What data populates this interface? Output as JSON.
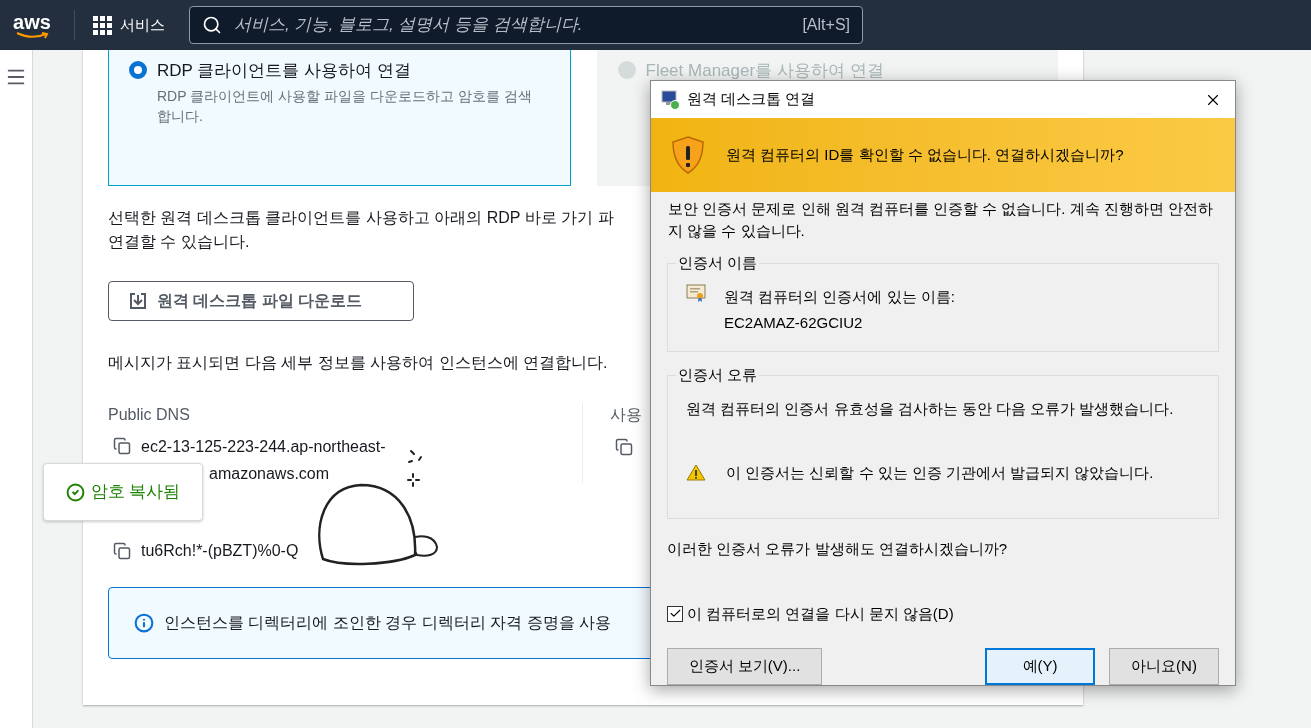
{
  "nav": {
    "logo": "aws",
    "services": "서비스",
    "search_placeholder": "서비스, 기능, 블로그, 설명서 등을 검색합니다.",
    "shortcut": "[Alt+S]"
  },
  "connect_options": [
    {
      "title": "RDP 클라이언트를 사용하여 연결",
      "description": "RDP 클라이언트에 사용할 파일을 다운로드하고 암호를 검색합니다.",
      "selected": true
    },
    {
      "title": "Fleet Manager를 사용하여 연결",
      "selected": false
    }
  ],
  "intro_lines": [
    "선택한 원격 데스크톱 클라이언트를 사용하고 아래의 RDP 바로 가기 파",
    "연결할 수 있습니다."
  ],
  "download_button": "원격 데스크톱 파일 다운로드",
  "message": "메시지가 표시되면 다음 세부 정보를 사용하여 인스턴스에 연결합니다.",
  "details": {
    "dns_label": "Public DNS",
    "dns_lines": [
      "ec2-13-125-223-244.ap-northeast-",
      "amazonaws.com"
    ],
    "password": "tu6Rch!*-(pBZT)%0-Q",
    "column_2_label": "사용"
  },
  "toast": "암호 복사됨",
  "info": "인스턴스를 디렉터리에 조인한 경우 디렉터리 자격 증명을 사용",
  "dialog": {
    "title": "원격 데스크톱 연결",
    "banner": "원격 컴퓨터의 ID를 확인할 수 없습니다. 연결하시겠습니까?",
    "body": "보안 인증서 문제로 인해 원격 컴퓨터를 인증할 수 없습니다. 계속 진행하면 안전하지 않을 수 있습니다.",
    "groups": [
      {
        "kind": "name",
        "title": "인증서 이름",
        "label": "원격 컴퓨터의 인증서에 있는 이름:",
        "value": "EC2AMAZ-62GCIU2"
      },
      {
        "kind": "error",
        "title": "인증서 오류",
        "label": "원격 컴퓨터의 인증서 유효성을 검사하는 동안 다음 오류가 발생했습니다.",
        "value": "이 인증서는 신뢰할 수 있는 인증 기관에서 발급되지 않았습니다."
      }
    ],
    "question": "이러한 인증서 오류가 발생해도 연결하시겠습니까?",
    "checkbox": {
      "label": "이 컴퓨터로의 연결을 다시 묻지 않음(D)",
      "checked": true
    },
    "buttons": [
      {
        "label": "인증서 보기(V)...",
        "focused": false
      },
      {
        "label": "예(Y)",
        "focused": true
      },
      {
        "label": "아니요(N)",
        "focused": false
      }
    ]
  }
}
